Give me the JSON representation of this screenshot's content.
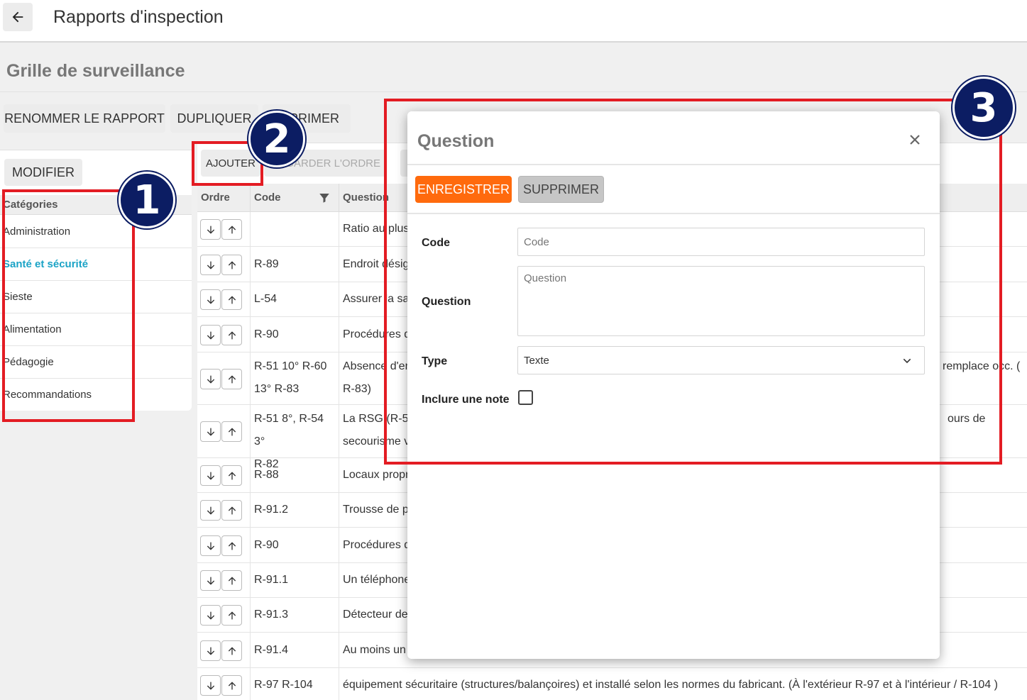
{
  "header": {
    "title": "Rapports d'inspection"
  },
  "page": {
    "title": "Grille de surveillance"
  },
  "toolbar": {
    "rename": "RENOMMER LE RAPPORT",
    "duplicate": "DUPLIQUER",
    "delete_partial": "PRIMER"
  },
  "left": {
    "modify": "MODIFIER",
    "header": "Catégories",
    "items": [
      {
        "label": "Administration"
      },
      {
        "label": "Santé et sécurité"
      },
      {
        "label": "Sieste"
      },
      {
        "label": "Alimentation"
      },
      {
        "label": "Pédagogie"
      },
      {
        "label": "Recommandations"
      }
    ]
  },
  "table": {
    "add": "AJOUTER",
    "save_order": "VEGARDER L'ORDRE",
    "columns": {
      "ordre": "Ordre",
      "code": "Code",
      "question": "Question"
    },
    "rows": [
      {
        "code": "",
        "code2": "",
        "q": "Ratio au plus",
        "q2": ""
      },
      {
        "code": "R-89",
        "code2": "",
        "q": "Endroit désig",
        "q2": ""
      },
      {
        "code": "L-54",
        "code2": "",
        "q": "Assurer la sa",
        "q2": ""
      },
      {
        "code": "R-90",
        "code2": "",
        "q": "Procédures d",
        "q2": ""
      },
      {
        "code": "R-51 10° R-60",
        "code2": "13° R-83",
        "q": "Absence d'en",
        "q2": "R-83)",
        "q_right": "remplace occ. ("
      },
      {
        "code": "R-51 8°, R-54 3°",
        "code2": "R-82",
        "q": "La RSG (R-51",
        "q2": "secourisme v",
        "q_right": "ours de"
      },
      {
        "code": "R-88",
        "code2": "",
        "q": "Locaux propr",
        "q2": ""
      },
      {
        "code": "R-91.2",
        "code2": "",
        "q": "Trousse de p",
        "q2": ""
      },
      {
        "code": "R-90",
        "code2": "",
        "q": "Procédures d",
        "q2": ""
      },
      {
        "code": "R-91.1",
        "code2": "",
        "q": "Un téléphone",
        "q2": ""
      },
      {
        "code": "R-91.3",
        "code2": "",
        "q": "Détecteur de",
        "q2": ""
      },
      {
        "code": "R-91.4",
        "code2": "",
        "q": "Au moins un",
        "q2": ""
      },
      {
        "code": "R-97 R-104",
        "code2": "",
        "q": "équipement sécuritaire (structures/balançoires) et installé selon les normes du fabricant. (À l'extérieur R-97 et à l'intérieur / R-104 )",
        "q2": ""
      }
    ]
  },
  "modal": {
    "title": "Question",
    "save": "ENREGISTRER",
    "delete": "SUPPRIMER",
    "code_label": "Code",
    "code_placeholder": "Code",
    "question_label": "Question",
    "question_placeholder": "Question",
    "type_label": "Type",
    "type_value": "Texte",
    "note_label": "Inclure une note"
  },
  "annotations": {
    "one": "1",
    "two": "2",
    "three": "3"
  },
  "colors": {
    "accent": "#ff6a0d",
    "active_category": "#1ba3c6",
    "annotation_red": "#e31c23",
    "badge_navy": "#0c1d63"
  }
}
